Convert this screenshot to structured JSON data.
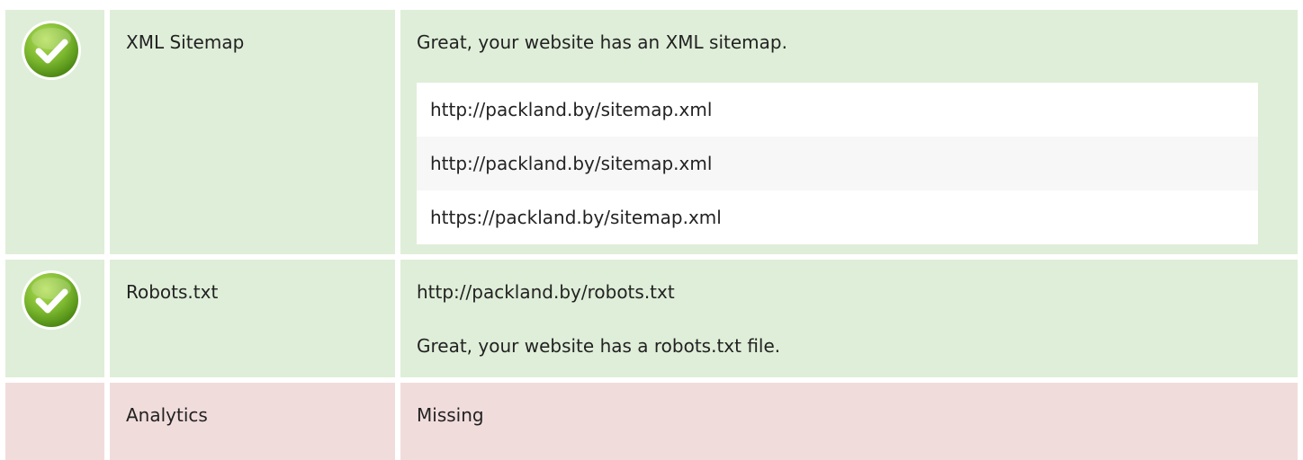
{
  "rows": [
    {
      "status": "pass",
      "icon": "check-icon",
      "name": "XML Sitemap",
      "message": "Great, your website has an XML sitemap.",
      "urls": [
        "http://packland.by/sitemap.xml",
        "http://packland.by/sitemap.xml",
        "https://packland.by/sitemap.xml"
      ]
    },
    {
      "status": "pass",
      "icon": "check-icon",
      "name": "Robots.txt",
      "url": "http://packland.by/robots.txt",
      "message": "Great, your website has a robots.txt file."
    },
    {
      "status": "fail",
      "name": "Analytics",
      "value": "Missing"
    }
  ],
  "colors": {
    "pass_bg": "#dfeed8",
    "fail_bg": "#f1dcdc",
    "check_green": "#7cb82f",
    "text": "#222222"
  }
}
